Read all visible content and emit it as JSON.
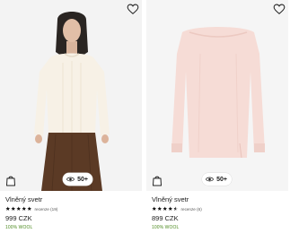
{
  "products": [
    {
      "title": "Vlněný svetr",
      "rating": 5,
      "reviews_text": "recenze (19)",
      "price": "999 CZK",
      "tag": "100% WOOL",
      "views": "50+",
      "image_icon": "model-wearing-cream-sweater",
      "tag_color": "#4c8a1f"
    },
    {
      "title": "Vlněný svetr",
      "rating": 4.5,
      "reviews_text": "recenze (6)",
      "price": "899 CZK",
      "tag": "100% WOOL",
      "views": "50+",
      "image_icon": "pink-sweater-flatlay",
      "tag_color": "#4c8a1f"
    }
  ],
  "icons": {
    "favorite": "heart-outline-icon",
    "cart": "shopping-bag-icon",
    "views": "eye-icon",
    "star": "star-icon"
  }
}
